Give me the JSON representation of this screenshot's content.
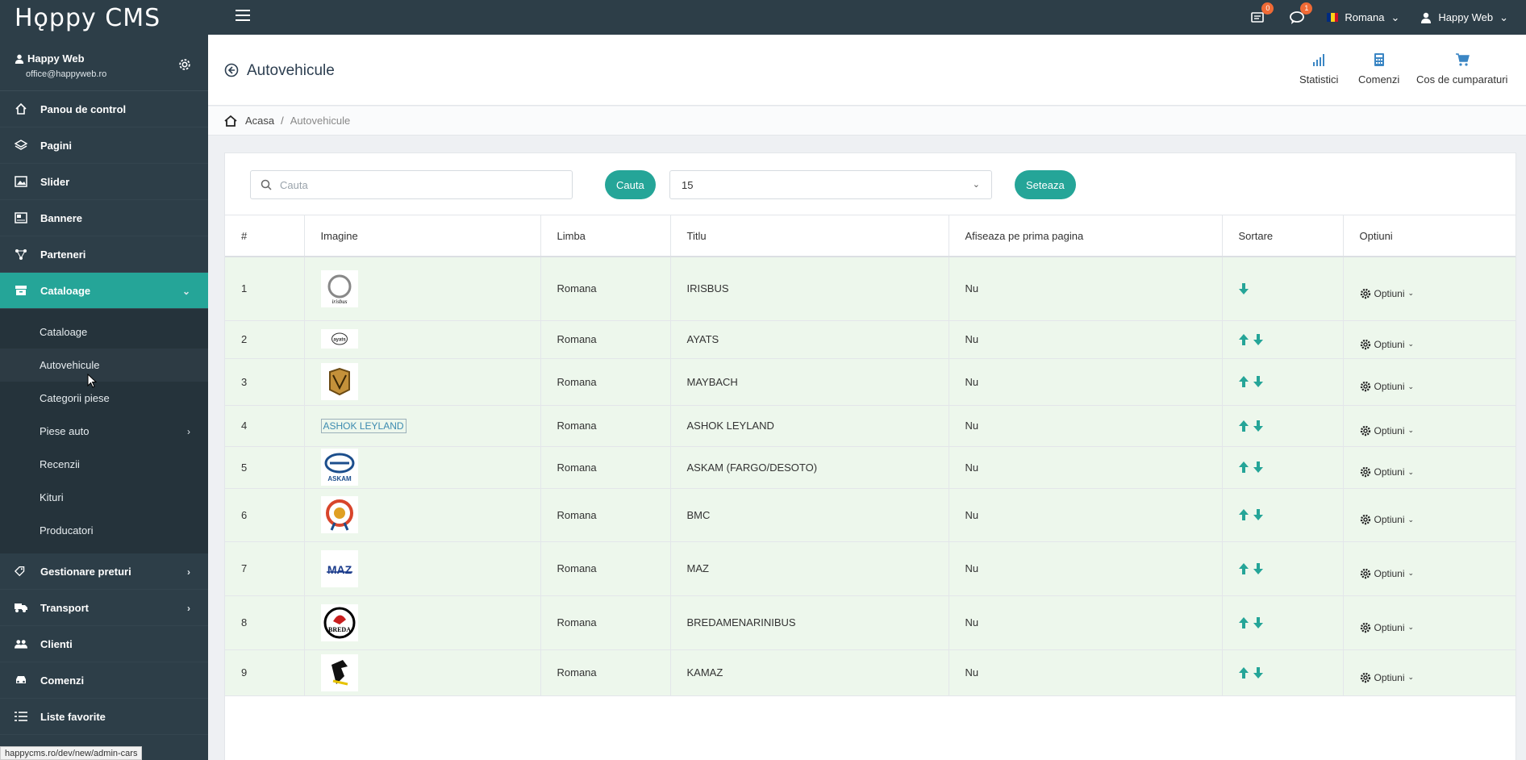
{
  "app": {
    "logo": "Hǫppy CMS",
    "status_url": "happycms.ro/dev/new/admin-cars"
  },
  "topbar": {
    "notif_count": "0",
    "messages_count": "1",
    "language": "Romana",
    "user": "Happy Web"
  },
  "sidebar": {
    "profile_name": "Happy Web",
    "profile_email": "office@happyweb.ro",
    "items_top": [
      {
        "label": "Panou de control",
        "icon": "home-icon"
      },
      {
        "label": "Pagini",
        "icon": "layers-icon"
      },
      {
        "label": "Slider",
        "icon": "image-icon"
      },
      {
        "label": "Bannere",
        "icon": "banner-icon"
      },
      {
        "label": "Parteneri",
        "icon": "network-icon"
      },
      {
        "label": "Cataloage",
        "icon": "archive-icon"
      }
    ],
    "submenu": [
      {
        "label": "Cataloage"
      },
      {
        "label": "Autovehicule"
      },
      {
        "label": "Categorii piese"
      },
      {
        "label": "Piese auto"
      },
      {
        "label": "Recenzii"
      },
      {
        "label": "Kituri"
      },
      {
        "label": "Producatori"
      }
    ],
    "items_bottom": [
      {
        "label": "Gestionare preturi",
        "icon": "tags-icon"
      },
      {
        "label": "Transport",
        "icon": "truck-icon"
      },
      {
        "label": "Clienti",
        "icon": "users-icon"
      },
      {
        "label": "Comenzi",
        "icon": "car-icon"
      },
      {
        "label": "Liste favorite",
        "icon": "list-icon"
      }
    ]
  },
  "header": {
    "title": "Autovehicule",
    "quick_links": [
      {
        "label": "Statistici",
        "icon": "signal-icon"
      },
      {
        "label": "Comenzi",
        "icon": "calculator-icon"
      },
      {
        "label": "Cos de cumparaturi",
        "icon": "cart-icon"
      }
    ]
  },
  "breadcrumb": {
    "home": "Acasa",
    "separator": "/",
    "current": "Autovehicule"
  },
  "toolbar": {
    "search_placeholder": "Cauta",
    "search_button": "Cauta",
    "per_page": "15",
    "set_button": "Seteaza"
  },
  "table": {
    "columns": [
      "#",
      "Imagine",
      "Limba",
      "Titlu",
      "Afiseaza pe prima pagina",
      "Sortare",
      "Optiuni"
    ],
    "options_label": "Optiuni",
    "rows": [
      {
        "num": "1",
        "lang": "Romana",
        "title": "IRISBUS",
        "home": "Nu",
        "logo_text": "irisbus"
      },
      {
        "num": "2",
        "lang": "Romana",
        "title": "AYATS",
        "home": "Nu",
        "logo_text": "ayats"
      },
      {
        "num": "3",
        "lang": "Romana",
        "title": "MAYBACH",
        "home": "Nu",
        "logo_text": ""
      },
      {
        "num": "4",
        "lang": "Romana",
        "title": "ASHOK LEYLAND",
        "home": "Nu",
        "logo_text": "ASHOK LEYLAND"
      },
      {
        "num": "5",
        "lang": "Romana",
        "title": "ASKAM (FARGO/DESOTO)",
        "home": "Nu",
        "logo_text": "ASKAM"
      },
      {
        "num": "6",
        "lang": "Romana",
        "title": "BMC",
        "home": "Nu",
        "logo_text": ""
      },
      {
        "num": "7",
        "lang": "Romana",
        "title": "MAZ",
        "home": "Nu",
        "logo_text": "MAZ"
      },
      {
        "num": "8",
        "lang": "Romana",
        "title": "BREDAMENARINIBUS",
        "home": "Nu",
        "logo_text": "BREDA"
      },
      {
        "num": "9",
        "lang": "Romana",
        "title": "KAMAZ",
        "home": "Nu",
        "logo_text": ""
      }
    ]
  },
  "colors": {
    "sidebar_bg": "#2d3e48",
    "accent": "#25a598",
    "row_bg": "#edf7ec",
    "badge": "#f06a35"
  }
}
